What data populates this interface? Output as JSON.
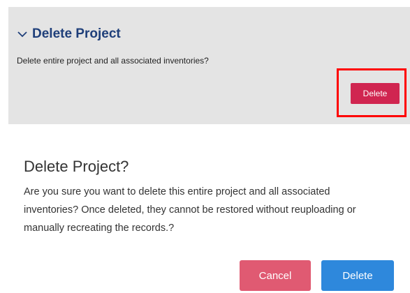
{
  "panel": {
    "title": "Delete Project",
    "description": "Delete entire project and all associated inventories?",
    "delete_label": "Delete",
    "chevron_icon": "chevron-down-icon"
  },
  "dialog": {
    "title": "Delete Project?",
    "body": "Are you sure you want to delete this entire project and all associated inventories? Once deleted, they cannot be restored without reuploading or manually recreating the records.?",
    "cancel_label": "Cancel",
    "delete_label": "Delete"
  },
  "colors": {
    "panel_bg": "#e4e4e4",
    "title_blue": "#1f3f7a",
    "danger": "#d02550",
    "cancel": "#e05a72",
    "primary": "#2e88dc",
    "highlight": "#ff0000"
  }
}
